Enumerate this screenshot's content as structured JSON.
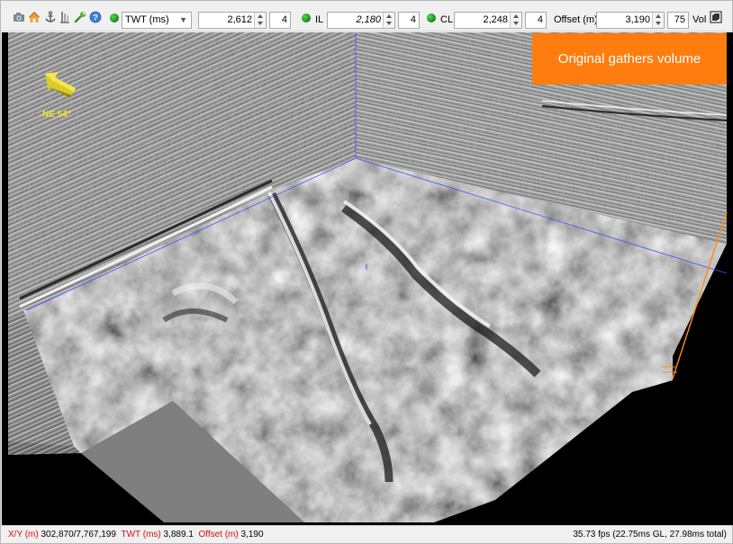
{
  "toolbar": {
    "icons": [
      "camera-icon",
      "home-icon",
      "anchor-icon",
      "well-icon",
      "wrench-icon",
      "help-icon"
    ],
    "domain_select": {
      "value": "TWT (ms)"
    },
    "twt": {
      "value": "2,612",
      "step": "4"
    },
    "il": {
      "label": "IL",
      "value": "2,180",
      "step": "4"
    },
    "cl": {
      "label": "CL",
      "value": "2,248",
      "step": "4"
    },
    "offset": {
      "label": "Offset (m)",
      "value": "3,190",
      "step": "75"
    },
    "vol_label": "Vol"
  },
  "viewport": {
    "overlay_title": "Original gathers volume",
    "compass": {
      "label": "NE 54°"
    }
  },
  "status": {
    "xy_label": "X/Y (m)",
    "xy_value": "302,870/7,767,199",
    "twt_label": "TWT (ms)",
    "twt_value": "3,889.1",
    "offset_label": "Offset (m)",
    "offset_value": "3,190",
    "performance": "35.73 fps (22.75ms GL, 27.98ms total)"
  },
  "colors": {
    "overlay_background": "#ff7c0e",
    "status_label": "#d01010",
    "active_indicator": "#118811",
    "compass": "#f3e530"
  }
}
